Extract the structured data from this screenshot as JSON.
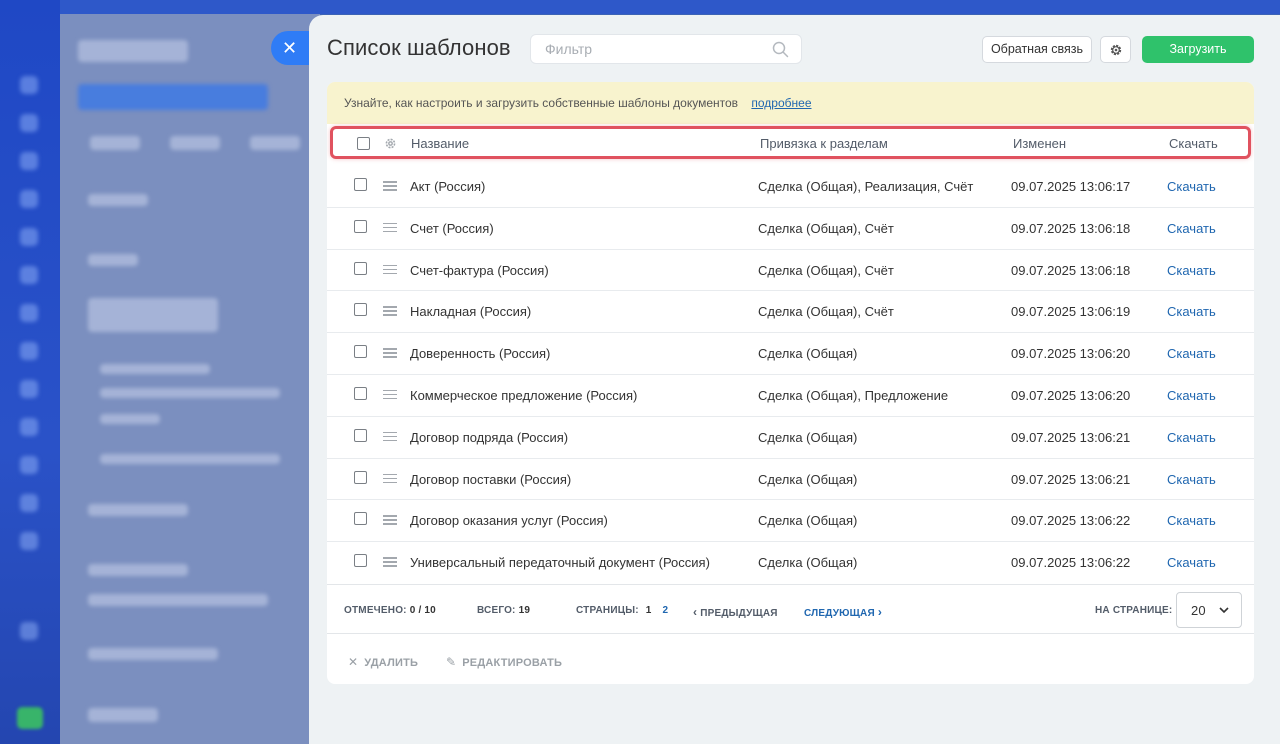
{
  "panel": {
    "title": "Список шаблонов",
    "filter_placeholder": "Фильтр",
    "feedback_label": "Обратная связь",
    "upload_label": "Загрузить"
  },
  "banner": {
    "text": "Узнайте, как настроить и загрузить собственные шаблоны документов",
    "link": "подробнее"
  },
  "table": {
    "columns": [
      "Название",
      "Привязка к разделам",
      "Изменен",
      "Скачать"
    ],
    "rows": [
      {
        "name": "Акт (Россия)",
        "sections": "Сделка (Общая), Реализация, Счёт",
        "modified": "09.07.2025 13:06:17",
        "download": "Скачать"
      },
      {
        "name": "Счет (Россия)",
        "sections": "Сделка (Общая), Счёт",
        "modified": "09.07.2025 13:06:18",
        "download": "Скачать"
      },
      {
        "name": "Счет-фактура (Россия)",
        "sections": "Сделка (Общая), Счёт",
        "modified": "09.07.2025 13:06:18",
        "download": "Скачать"
      },
      {
        "name": "Накладная (Россия)",
        "sections": "Сделка (Общая), Счёт",
        "modified": "09.07.2025 13:06:19",
        "download": "Скачать"
      },
      {
        "name": "Доверенность (Россия)",
        "sections": "Сделка (Общая)",
        "modified": "09.07.2025 13:06:20",
        "download": "Скачать"
      },
      {
        "name": "Коммерческое предложение (Россия)",
        "sections": "Сделка (Общая), Предложение",
        "modified": "09.07.2025 13:06:20",
        "download": "Скачать"
      },
      {
        "name": "Договор подряда (Россия)",
        "sections": "Сделка (Общая)",
        "modified": "09.07.2025 13:06:21",
        "download": "Скачать"
      },
      {
        "name": "Договор поставки (Россия)",
        "sections": "Сделка (Общая)",
        "modified": "09.07.2025 13:06:21",
        "download": "Скачать"
      },
      {
        "name": "Договор оказания услуг (Россия)",
        "sections": "Сделка (Общая)",
        "modified": "09.07.2025 13:06:22",
        "download": "Скачать"
      },
      {
        "name": "Универсальный передаточный документ (Россия)",
        "sections": "Сделка (Общая)",
        "modified": "09.07.2025 13:06:22",
        "download": "Скачать"
      }
    ]
  },
  "pager": {
    "selected_label": "ОТМЕЧЕНО:",
    "selected_value": "0 / 10",
    "total_label": "ВСЕГО:",
    "total_value": "19",
    "pages_label": "СТРАНИЦЫ:",
    "page1": "1",
    "page2": "2",
    "prev_label": "ПРЕДЫДУЩАЯ",
    "next_label": "СЛЕДУЮЩАЯ",
    "per_page_label": "НА СТРАНИЦЕ:",
    "per_page_value": "20"
  },
  "actions": {
    "delete_label": "УДАЛИТЬ",
    "edit_label": "РЕДАКТИРОВАТЬ"
  },
  "colors": {
    "accent_green": "#2fc26b",
    "link_blue": "#2067b0",
    "highlight_red": "#e0525f",
    "banner_yellow": "#f8f3ce"
  }
}
